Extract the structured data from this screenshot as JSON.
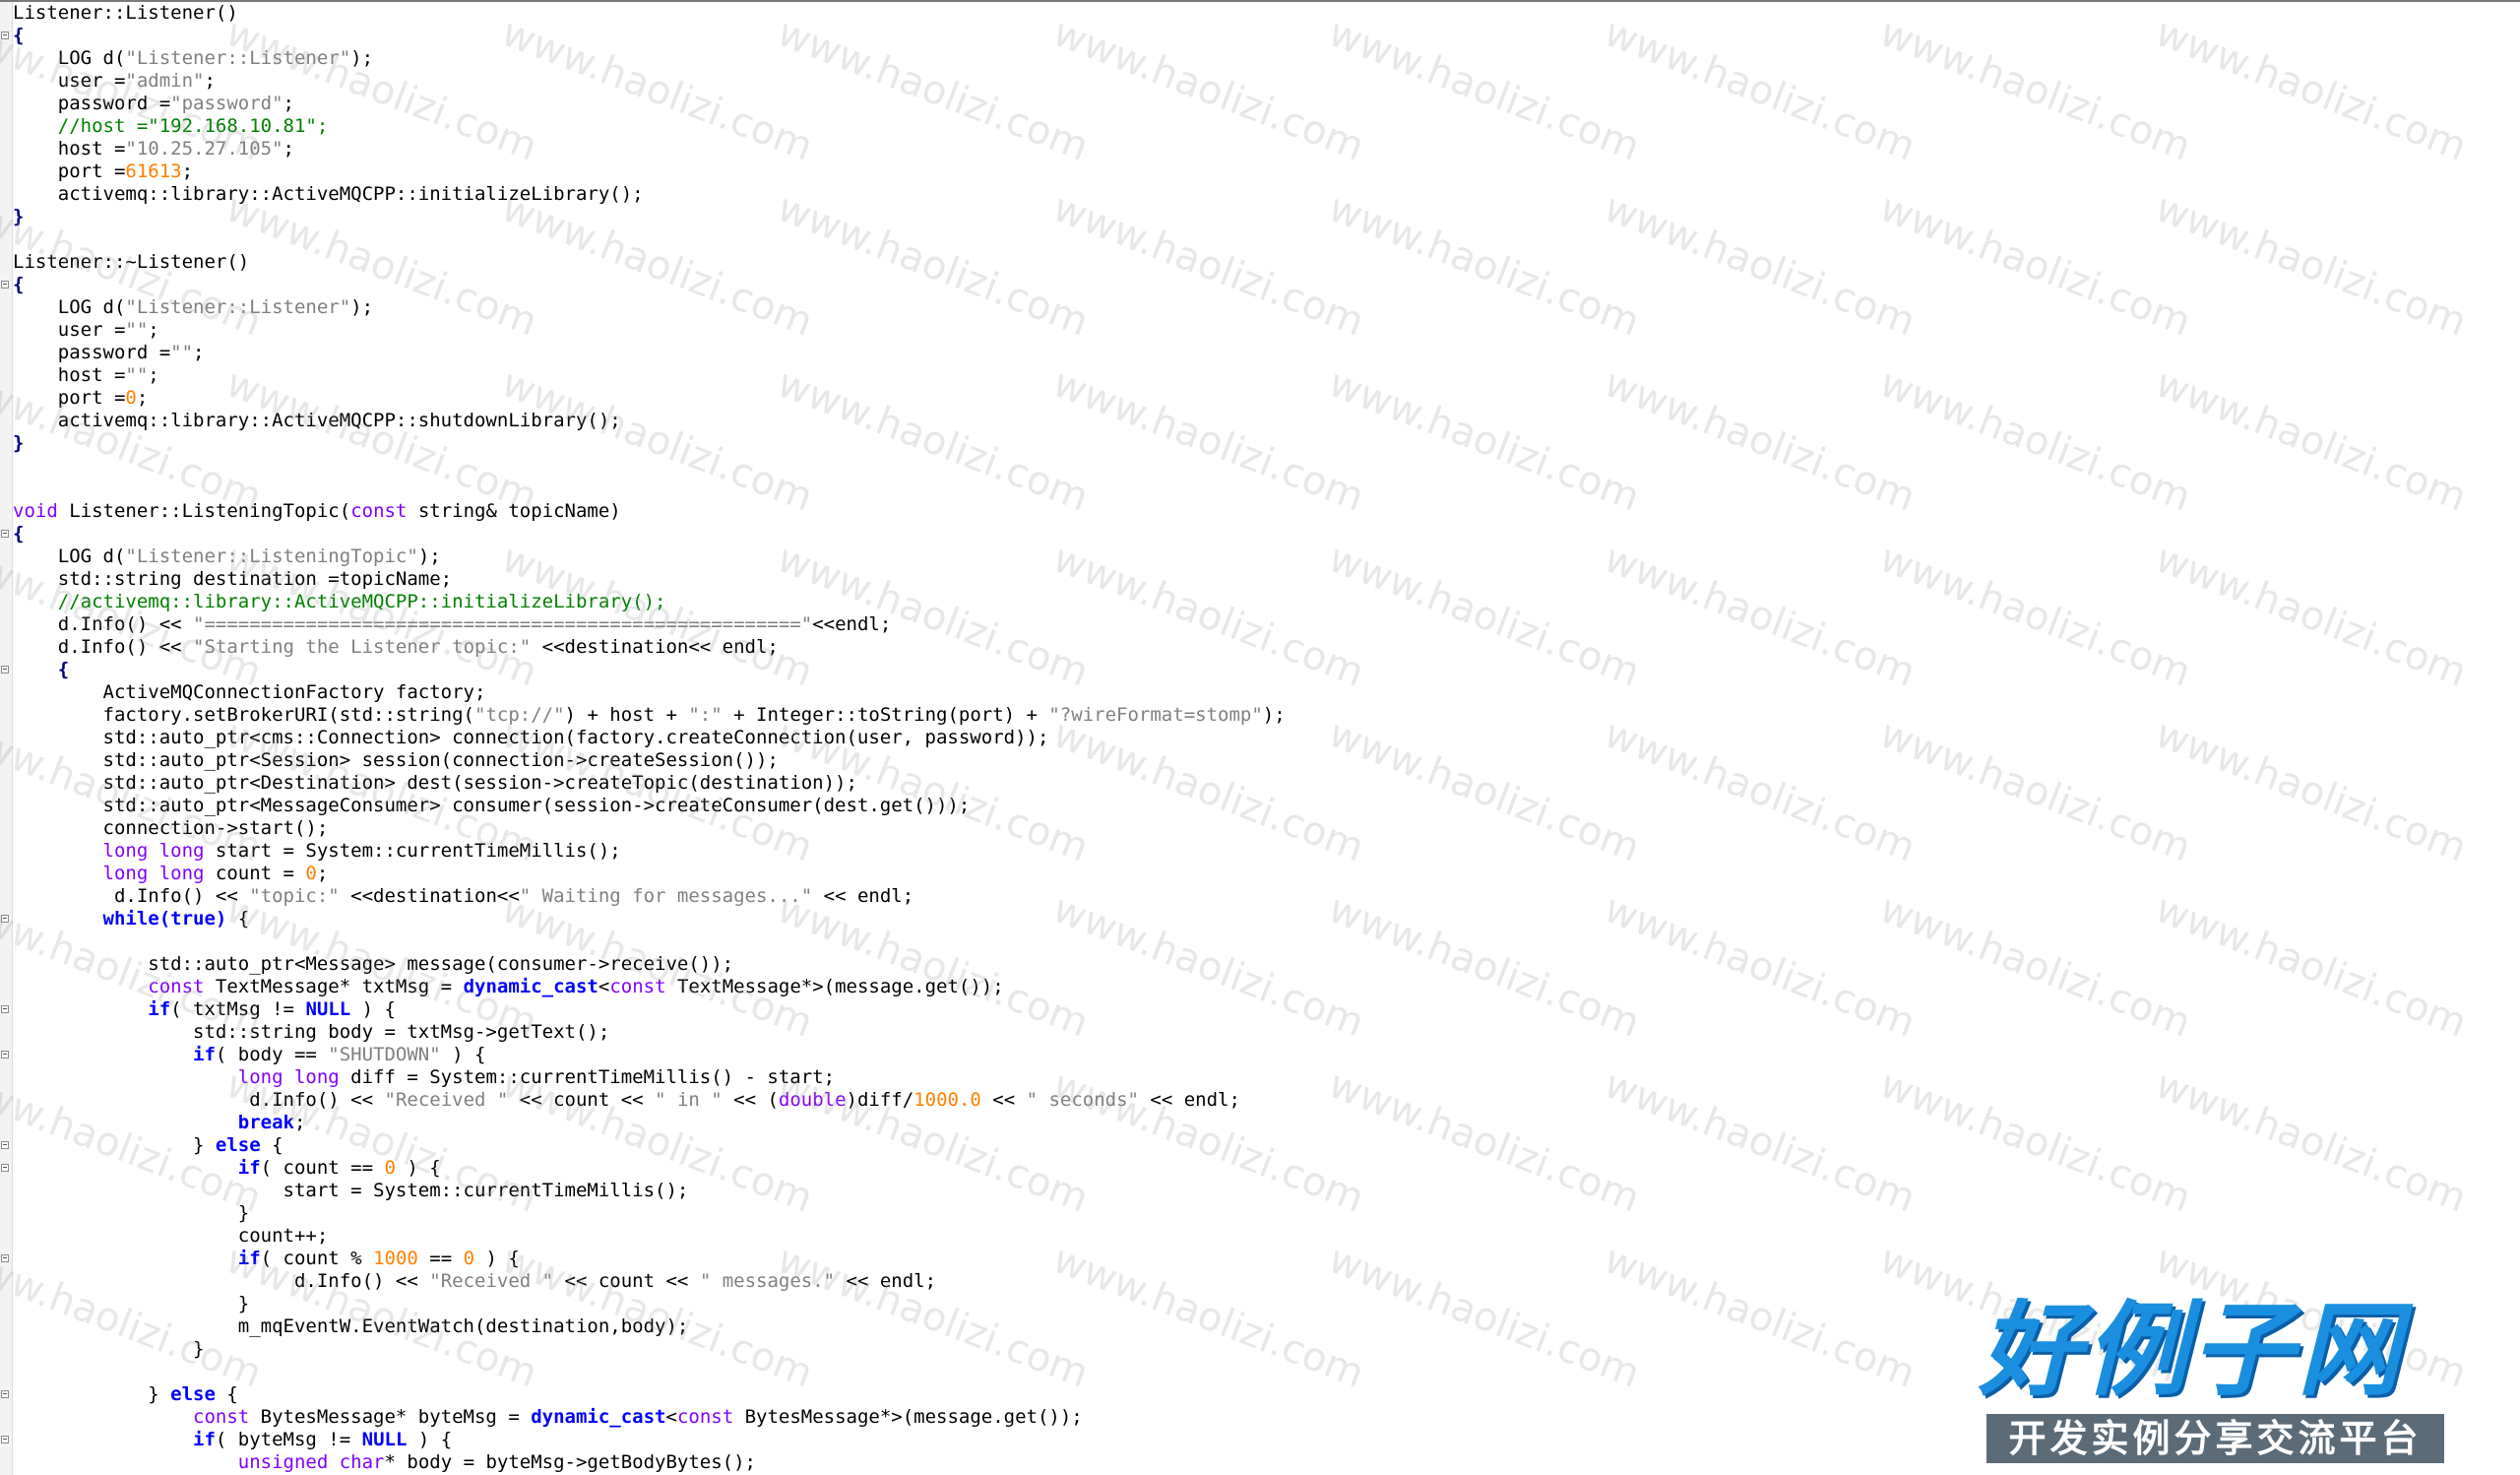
{
  "editor": {
    "lines": [
      [
        {
          "t": "pl",
          "s": "Listener::Listener()"
        }
      ],
      [
        {
          "t": "op",
          "s": "{"
        }
      ],
      [
        {
          "t": "pl",
          "s": "    LOG d("
        },
        {
          "t": "str",
          "s": "\"Listener::Listener\""
        },
        {
          "t": "pl",
          "s": ");"
        }
      ],
      [
        {
          "t": "pl",
          "s": "    user ="
        },
        {
          "t": "str",
          "s": "\"admin\""
        },
        {
          "t": "pl",
          "s": ";"
        }
      ],
      [
        {
          "t": "pl",
          "s": "    password ="
        },
        {
          "t": "str",
          "s": "\"password\""
        },
        {
          "t": "pl",
          "s": ";"
        }
      ],
      [
        {
          "t": "cmt",
          "s": "    //host =\"192.168.10.81\";"
        }
      ],
      [
        {
          "t": "pl",
          "s": "    host ="
        },
        {
          "t": "str",
          "s": "\"10.25.27.105\""
        },
        {
          "t": "pl",
          "s": ";"
        }
      ],
      [
        {
          "t": "pl",
          "s": "    port ="
        },
        {
          "t": "num",
          "s": "61613"
        },
        {
          "t": "pl",
          "s": ";"
        }
      ],
      [
        {
          "t": "pl",
          "s": "    activemq::library::ActiveMQCPP::initializeLibrary();"
        }
      ],
      [
        {
          "t": "op",
          "s": "}"
        }
      ],
      [
        {
          "t": "pl",
          "s": ""
        }
      ],
      [
        {
          "t": "pl",
          "s": "Listener::~Listener()"
        }
      ],
      [
        {
          "t": "op",
          "s": "{"
        }
      ],
      [
        {
          "t": "pl",
          "s": "    LOG d("
        },
        {
          "t": "str",
          "s": "\"Listener::Listener\""
        },
        {
          "t": "pl",
          "s": ");"
        }
      ],
      [
        {
          "t": "pl",
          "s": "    user ="
        },
        {
          "t": "str",
          "s": "\"\""
        },
        {
          "t": "pl",
          "s": ";"
        }
      ],
      [
        {
          "t": "pl",
          "s": "    password ="
        },
        {
          "t": "str",
          "s": "\"\""
        },
        {
          "t": "pl",
          "s": ";"
        }
      ],
      [
        {
          "t": "pl",
          "s": "    host ="
        },
        {
          "t": "str",
          "s": "\"\""
        },
        {
          "t": "pl",
          "s": ";"
        }
      ],
      [
        {
          "t": "pl",
          "s": "    port ="
        },
        {
          "t": "num",
          "s": "0"
        },
        {
          "t": "pl",
          "s": ";"
        }
      ],
      [
        {
          "t": "pl",
          "s": "    activemq::library::ActiveMQCPP::shutdownLibrary();"
        }
      ],
      [
        {
          "t": "op",
          "s": "}"
        }
      ],
      [
        {
          "t": "pl",
          "s": ""
        }
      ],
      [
        {
          "t": "pl",
          "s": ""
        }
      ],
      [
        {
          "t": "type",
          "s": "void"
        },
        {
          "t": "pl",
          "s": " Listener::ListeningTopic("
        },
        {
          "t": "type",
          "s": "const"
        },
        {
          "t": "pl",
          "s": " string& topicName)"
        }
      ],
      [
        {
          "t": "op",
          "s": "{"
        }
      ],
      [
        {
          "t": "pl",
          "s": "    LOG d("
        },
        {
          "t": "str",
          "s": "\"Listener::ListeningTopic\""
        },
        {
          "t": "pl",
          "s": ");"
        }
      ],
      [
        {
          "t": "pl",
          "s": "    std::string destination =topicName;"
        }
      ],
      [
        {
          "t": "cmt",
          "s": "    //activemq::library::ActiveMQCPP::initializeLibrary();"
        }
      ],
      [
        {
          "t": "pl",
          "s": "    d.Info() << "
        },
        {
          "t": "str",
          "s": "\"=====================================================\""
        },
        {
          "t": "pl",
          "s": "<<endl;"
        }
      ],
      [
        {
          "t": "pl",
          "s": "    d.Info() << "
        },
        {
          "t": "str",
          "s": "\"Starting the Listener topic:\""
        },
        {
          "t": "pl",
          "s": " <<destination<< endl;"
        }
      ],
      [
        {
          "t": "op",
          "s": "    {"
        }
      ],
      [
        {
          "t": "pl",
          "s": "        ActiveMQConnectionFactory factory;"
        }
      ],
      [
        {
          "t": "pl",
          "s": "        factory.setBrokerURI(std::string("
        },
        {
          "t": "str",
          "s": "\"tcp://\""
        },
        {
          "t": "pl",
          "s": ") + host + "
        },
        {
          "t": "str",
          "s": "\":\""
        },
        {
          "t": "pl",
          "s": " + Integer::toString(port) + "
        },
        {
          "t": "str",
          "s": "\"?wireFormat=stomp\""
        },
        {
          "t": "pl",
          "s": ");"
        }
      ],
      [
        {
          "t": "pl",
          "s": "        std::auto_ptr<cms::Connection> connection(factory.createConnection(user, password));"
        }
      ],
      [
        {
          "t": "pl",
          "s": "        std::auto_ptr<Session> session(connection->createSession());"
        }
      ],
      [
        {
          "t": "pl",
          "s": "        std::auto_ptr<Destination> dest(session->createTopic(destination));"
        }
      ],
      [
        {
          "t": "pl",
          "s": "        std::auto_ptr<MessageConsumer> consumer(session->createConsumer(dest.get()));"
        }
      ],
      [
        {
          "t": "pl",
          "s": "        connection->start();"
        }
      ],
      [
        {
          "t": "type",
          "s": "        long long"
        },
        {
          "t": "pl",
          "s": " start = System::currentTimeMillis();"
        }
      ],
      [
        {
          "t": "type",
          "s": "        long long"
        },
        {
          "t": "pl",
          "s": " count = "
        },
        {
          "t": "num",
          "s": "0"
        },
        {
          "t": "pl",
          "s": ";"
        }
      ],
      [
        {
          "t": "pl",
          "s": "         d.Info() << "
        },
        {
          "t": "str",
          "s": "\"topic:\""
        },
        {
          "t": "pl",
          "s": " <<destination<<"
        },
        {
          "t": "str",
          "s": "\" Waiting for messages...\""
        },
        {
          "t": "pl",
          "s": " << endl;"
        }
      ],
      [
        {
          "t": "kw",
          "s": "        while(true)"
        },
        {
          "t": "pl",
          "s": " {"
        }
      ],
      [
        {
          "t": "pl",
          "s": ""
        }
      ],
      [
        {
          "t": "pl",
          "s": "            std::auto_ptr<Message> message(consumer->receive());"
        }
      ],
      [
        {
          "t": "type",
          "s": "            const"
        },
        {
          "t": "pl",
          "s": " TextMessage* txtMsg = "
        },
        {
          "t": "kw",
          "s": "dynamic_cast"
        },
        {
          "t": "pl",
          "s": "<"
        },
        {
          "t": "type",
          "s": "const"
        },
        {
          "t": "pl",
          "s": " TextMessage*>(message.get());"
        }
      ],
      [
        {
          "t": "kw",
          "s": "            if"
        },
        {
          "t": "pl",
          "s": "( txtMsg != "
        },
        {
          "t": "kw",
          "s": "NULL"
        },
        {
          "t": "pl",
          "s": " ) {"
        }
      ],
      [
        {
          "t": "pl",
          "s": "                std::string body = txtMsg->getText();"
        }
      ],
      [
        {
          "t": "kw",
          "s": "                if"
        },
        {
          "t": "pl",
          "s": "( body == "
        },
        {
          "t": "str",
          "s": "\"SHUTDOWN\""
        },
        {
          "t": "pl",
          "s": " ) {"
        }
      ],
      [
        {
          "t": "type",
          "s": "                    long long"
        },
        {
          "t": "pl",
          "s": " diff = System::currentTimeMillis() - start;"
        }
      ],
      [
        {
          "t": "pl",
          "s": "                     d.Info() << "
        },
        {
          "t": "str",
          "s": "\"Received \""
        },
        {
          "t": "pl",
          "s": " << count << "
        },
        {
          "t": "str",
          "s": "\" in \""
        },
        {
          "t": "pl",
          "s": " << ("
        },
        {
          "t": "type",
          "s": "double"
        },
        {
          "t": "pl",
          "s": ")diff/"
        },
        {
          "t": "num",
          "s": "1000.0"
        },
        {
          "t": "pl",
          "s": " << "
        },
        {
          "t": "str",
          "s": "\" seconds\""
        },
        {
          "t": "pl",
          "s": " << endl;"
        }
      ],
      [
        {
          "t": "kw",
          "s": "                    break"
        },
        {
          "t": "pl",
          "s": ";"
        }
      ],
      [
        {
          "t": "pl",
          "s": "                } "
        },
        {
          "t": "kw",
          "s": "else"
        },
        {
          "t": "pl",
          "s": " {"
        }
      ],
      [
        {
          "t": "kw",
          "s": "                    if"
        },
        {
          "t": "pl",
          "s": "( count == "
        },
        {
          "t": "num",
          "s": "0"
        },
        {
          "t": "pl",
          "s": " ) {"
        }
      ],
      [
        {
          "t": "pl",
          "s": "                        start = System::currentTimeMillis();"
        }
      ],
      [
        {
          "t": "pl",
          "s": "                    }"
        }
      ],
      [
        {
          "t": "pl",
          "s": "                    count++;"
        }
      ],
      [
        {
          "t": "kw",
          "s": "                    if"
        },
        {
          "t": "pl",
          "s": "( count % "
        },
        {
          "t": "num",
          "s": "1000"
        },
        {
          "t": "pl",
          "s": " == "
        },
        {
          "t": "num",
          "s": "0"
        },
        {
          "t": "pl",
          "s": " ) {"
        }
      ],
      [
        {
          "t": "pl",
          "s": "                         d.Info() << "
        },
        {
          "t": "str",
          "s": "\"Received \""
        },
        {
          "t": "pl",
          "s": " << count << "
        },
        {
          "t": "str",
          "s": "\" messages.\""
        },
        {
          "t": "pl",
          "s": " << endl;"
        }
      ],
      [
        {
          "t": "pl",
          "s": "                    }"
        }
      ],
      [
        {
          "t": "pl",
          "s": "                    m_mqEventW.EventWatch(destination,body);"
        }
      ],
      [
        {
          "t": "pl",
          "s": "                }"
        }
      ],
      [
        {
          "t": "pl",
          "s": ""
        }
      ],
      [
        {
          "t": "pl",
          "s": "            } "
        },
        {
          "t": "kw",
          "s": "else"
        },
        {
          "t": "pl",
          "s": " {"
        }
      ],
      [
        {
          "t": "type",
          "s": "                const"
        },
        {
          "t": "pl",
          "s": " BytesMessage* byteMsg = "
        },
        {
          "t": "kw",
          "s": "dynamic_cast"
        },
        {
          "t": "pl",
          "s": "<"
        },
        {
          "t": "type",
          "s": "const"
        },
        {
          "t": "pl",
          "s": " BytesMessage*>(message.get());"
        }
      ],
      [
        {
          "t": "kw",
          "s": "                if"
        },
        {
          "t": "pl",
          "s": "( byteMsg != "
        },
        {
          "t": "kw",
          "s": "NULL"
        },
        {
          "t": "pl",
          "s": " ) {"
        }
      ],
      [
        {
          "t": "type",
          "s": "                    unsigned char"
        },
        {
          "t": "pl",
          "s": "* body = byteMsg->getBodyBytes();"
        }
      ]
    ]
  },
  "watermark": {
    "text": "www.haolizi.com"
  },
  "logo": {
    "main": "好例子网",
    "sub": "开发实例分享交流平台"
  },
  "colors": {
    "keyword": "#0000ff",
    "type": "#8000ff",
    "string": "#808080",
    "number": "#ff8000",
    "comment": "#008000"
  }
}
